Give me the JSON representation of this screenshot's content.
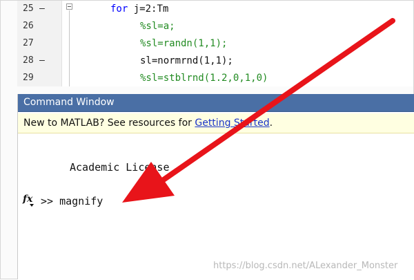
{
  "editor": {
    "lines": [
      {
        "num": "25",
        "bp": "–",
        "code": "for j=2:Tm",
        "keyword": "for",
        "rest": " j=2:Tm",
        "type": "keyword"
      },
      {
        "num": "26",
        "bp": "",
        "code": "%sl=a;",
        "type": "comment"
      },
      {
        "num": "27",
        "bp": "",
        "code": "%sl=randn(1,1);",
        "type": "comment"
      },
      {
        "num": "28",
        "bp": "–",
        "code": "sl=normrnd(1,1);",
        "type": "code"
      },
      {
        "num": "29",
        "bp": "",
        "code": "%sl=stblrnd(1.2,0,1,0)",
        "type": "comment"
      }
    ]
  },
  "command_window": {
    "title": "Command Window",
    "info_prefix": "New to MATLAB? See resources for ",
    "info_link": "Getting Started",
    "info_suffix": ".",
    "license_text": "Academic License",
    "prompt": ">> ",
    "command": "magnify",
    "fx_icon": "fx-icon"
  },
  "annotation": {
    "arrow_color": "#e8141a"
  },
  "watermark": "https://blog.csdn.net/ALexander_Monster"
}
